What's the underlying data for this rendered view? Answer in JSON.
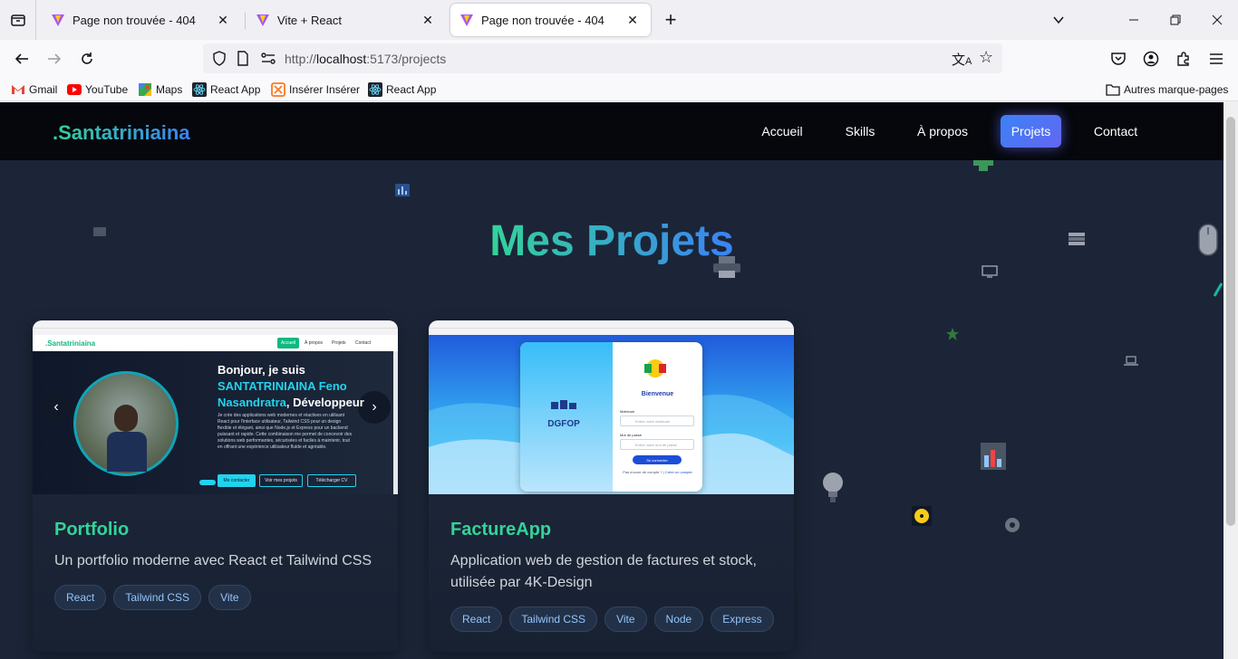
{
  "browser": {
    "tabs": [
      {
        "title": "Page non trouvée - 404",
        "active": false
      },
      {
        "title": "Vite + React",
        "active": false
      },
      {
        "title": "Page non trouvée - 404",
        "active": true
      }
    ],
    "url_prefix": "http://",
    "url_host": "localhost",
    "url_rest": ":5173/projects",
    "bookmarks": [
      {
        "label": "Gmail",
        "icon": "gmail-icon"
      },
      {
        "label": "YouTube",
        "icon": "youtube-icon"
      },
      {
        "label": "Maps",
        "icon": "maps-icon"
      },
      {
        "label": "React App",
        "icon": "react-icon"
      },
      {
        "label": "Insérer Insérer",
        "icon": "xampp-icon"
      },
      {
        "label": "React App",
        "icon": "react-icon"
      }
    ],
    "other_bookmarks": "Autres marque-pages"
  },
  "site": {
    "brand": ".Santatriniaina",
    "menu": [
      {
        "label": "Accueil",
        "active": false
      },
      {
        "label": "Skills",
        "active": false
      },
      {
        "label": "À propos",
        "active": false
      },
      {
        "label": "Projets",
        "active": true
      },
      {
        "label": "Contact",
        "active": false
      }
    ],
    "section_title": "Mes Projets",
    "projects": [
      {
        "title": "Portfolio",
        "description": "Un portfolio moderne avec React et Tailwind CSS",
        "tags": [
          "React",
          "Tailwind CSS",
          "Vite"
        ],
        "preview": {
          "brand": ".Santatriniaina",
          "menu": [
            "Accueil",
            "À propos",
            "Projets",
            "Contact"
          ],
          "greeting": "Bonjour, je suis",
          "name_highlight": "SANTATRINIAINA Feno Nasandratra",
          "role": ", Développeur",
          "bio": "Je crée des applications web modernes et réactives en utilisant React pour l'interface utilisateur, Tailwind CSS pour un design flexible et élégant, ainsi que Node.js et Express pour un backend puissant et rapide. Cette combinaison me permet de concevoir des solutions web performantes, sécurisées et faciles à maintenir, tout en offrant une expérience utilisateur fluide et agréable.",
          "btn_contact": "Me contacter",
          "btn_projects": "Voir mes projets",
          "btn_cv": "Télécharger CV"
        }
      },
      {
        "title": "FactureApp",
        "description": "Application web de gestion de factures et stock, utilisée par 4K-Design",
        "tags": [
          "React",
          "Tailwind CSS",
          "Vite",
          "Node",
          "Express"
        ],
        "preview": {
          "logo_text": "DGFOP",
          "welcome": "Bienvenue",
          "field1_label": "Matricule",
          "field1_placeholder": "Entrer votre matricule",
          "field2_label": "Mot de passe",
          "field2_placeholder": "Entrer votre mot de passe",
          "submit": "Se connecter",
          "signup_prompt": "Pas encore de compte ?",
          "signup_link": "Créer un compte"
        }
      }
    ]
  },
  "colors": {
    "accent_green": "#34d399",
    "accent_blue": "#3b82f6",
    "page_bg": "#1b2537",
    "header_bg": "#05070c"
  }
}
